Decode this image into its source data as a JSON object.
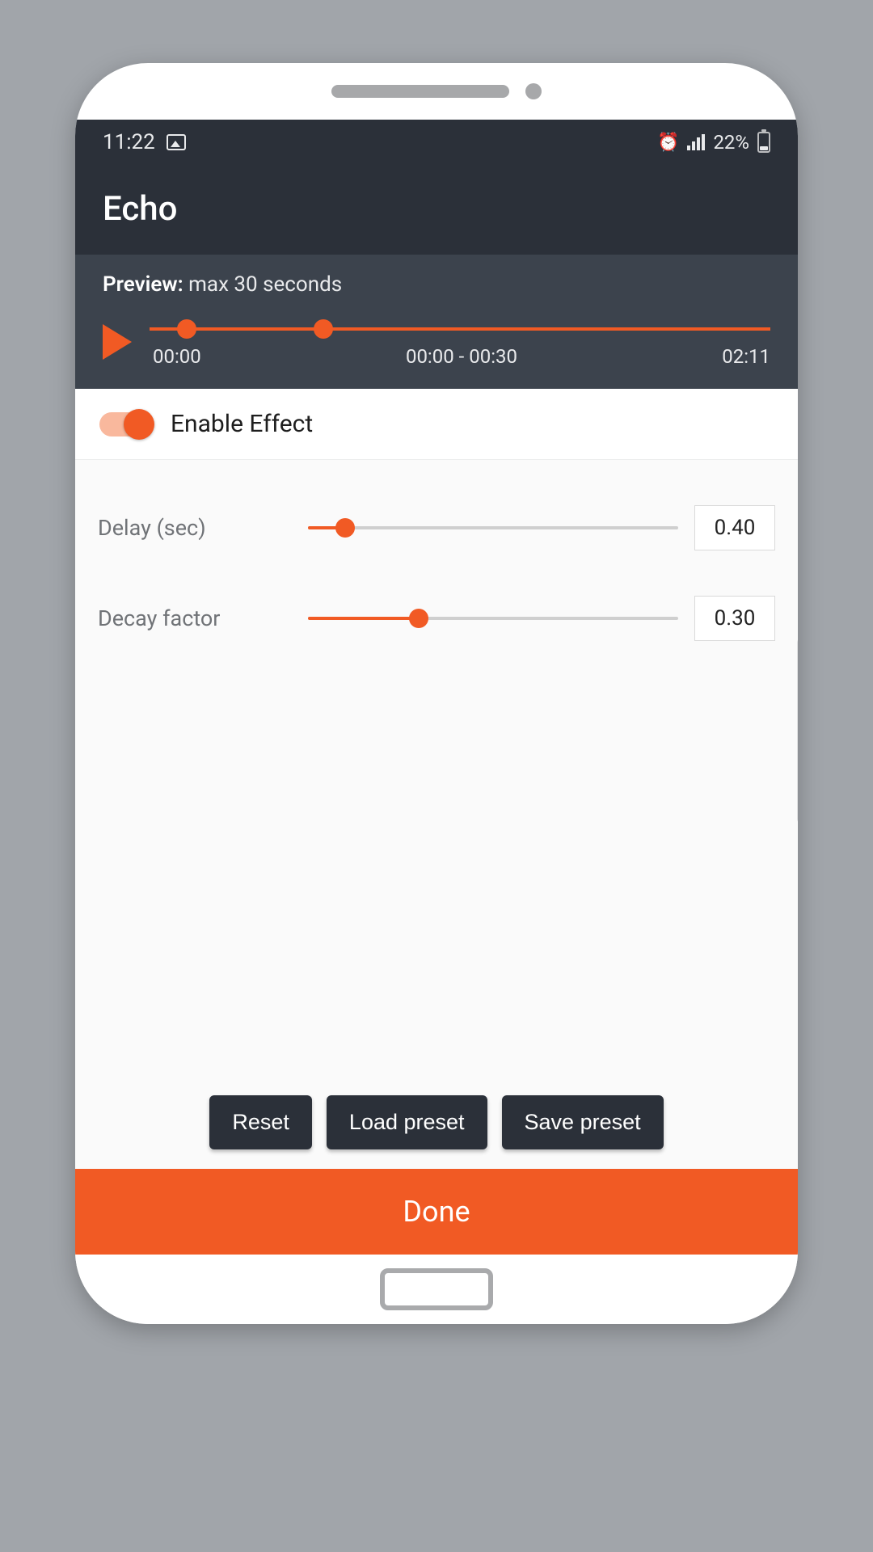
{
  "status": {
    "time": "11:22",
    "battery_pct": "22%"
  },
  "header": {
    "title": "Echo"
  },
  "preview": {
    "label": "Preview:",
    "hint": "max 30 seconds",
    "start_time": "00:00",
    "range": "00:00 - 00:30",
    "total": "02:11",
    "handle1_pct": 6,
    "handle2_pct": 28
  },
  "enable": {
    "label": "Enable Effect",
    "on": true
  },
  "sliders": [
    {
      "label": "Delay (sec)",
      "value": "0.40",
      "pct": 10
    },
    {
      "label": "Decay factor",
      "value": "0.30",
      "pct": 30
    }
  ],
  "buttons": {
    "reset": "Reset",
    "load": "Load preset",
    "save": "Save preset",
    "done": "Done"
  }
}
